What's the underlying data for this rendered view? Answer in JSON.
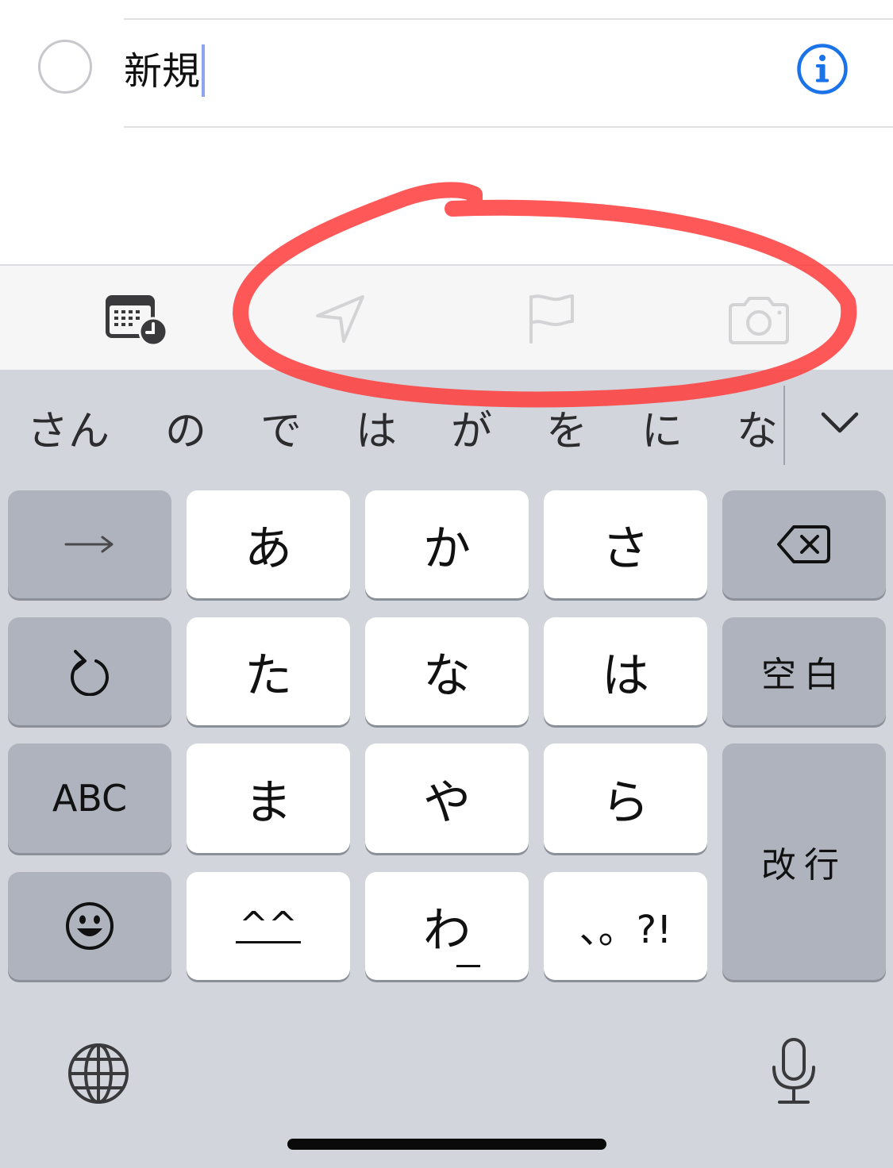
{
  "reminder": {
    "title": "新規"
  },
  "toolbar": {
    "icons": [
      "calendar-clock-icon",
      "location-arrow-icon",
      "flag-icon",
      "camera-icon"
    ]
  },
  "keyboard": {
    "candidates": [
      "さん",
      "の",
      "で",
      "は",
      "が",
      "を",
      "に",
      "な"
    ],
    "rows": [
      [
        "→",
        "あ",
        "か",
        "さ",
        "delete"
      ],
      [
        "undo",
        "た",
        "な",
        "は",
        "空白"
      ],
      [
        "ABC",
        "ま",
        "や",
        "ら",
        "改行"
      ],
      [
        "emoji",
        "^^",
        "わ",
        "、。?!"
      ]
    ],
    "labels": {
      "arrow": "→",
      "a": "あ",
      "ka": "か",
      "sa": "さ",
      "ta": "た",
      "na": "な",
      "ha": "は",
      "space": "空白",
      "abc": "ABC",
      "ma": "ま",
      "ya": "や",
      "ra": "ら",
      "return": "改行",
      "kaomoji": "^^",
      "wa": "わ",
      "punct": "、。?!"
    }
  },
  "colors": {
    "accent": "#1a73e8",
    "annotation": "#ff3b3b",
    "keyboard_bg": "#d2d5db",
    "key_white": "#ffffff",
    "key_gray": "#aeb3bd"
  }
}
